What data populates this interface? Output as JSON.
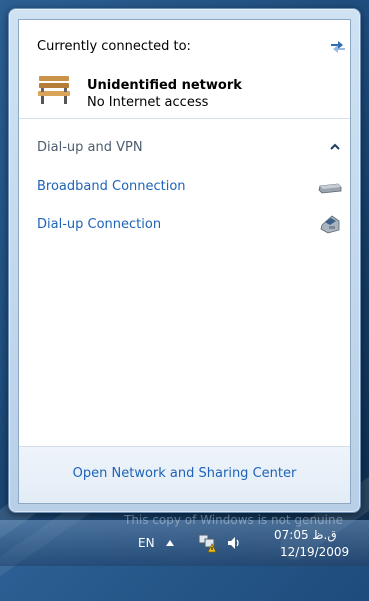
{
  "flyout": {
    "current_label": "Currently connected to:",
    "network": {
      "name": "Unidentified network",
      "status": "No Internet access"
    },
    "section_header": "Dial-up and VPN",
    "connections": [
      {
        "label": "Broadband Connection",
        "icon": "modem-icon"
      },
      {
        "label": "Dial-up Connection",
        "icon": "phone-icon"
      }
    ],
    "footer_link": "Open Network and Sharing Center"
  },
  "taskbar": {
    "watermark": "This copy of Windows is not genuine",
    "language": "EN",
    "time": "ق.ظ 07:05",
    "date": "12/19/2009"
  },
  "colors": {
    "link": "#1e63b8",
    "section": "#4d5d70"
  }
}
